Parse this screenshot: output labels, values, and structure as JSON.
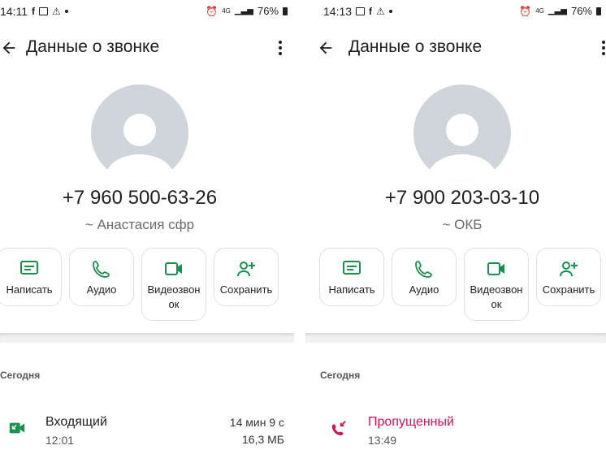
{
  "left": {
    "status": {
      "time": "14:11",
      "network": "4G",
      "battery": "76%"
    },
    "title": "Данные о звонке",
    "phone": "+7 960 500-63-26",
    "name": "~ Анастасия сфр",
    "actions": [
      {
        "label": "Написать",
        "icon": "message-icon"
      },
      {
        "label": "Аудио",
        "icon": "phone-icon"
      },
      {
        "label": "Видеозвон\nок",
        "icon": "video-icon"
      },
      {
        "label": "Сохранить",
        "icon": "add-contact-icon"
      }
    ],
    "section": "Сегодня",
    "call": {
      "type": "Входящий",
      "time": "12:01",
      "duration": "14 мин 9 с",
      "size": "16,3 МБ",
      "icon": "incoming-video-call-icon"
    }
  },
  "right": {
    "status": {
      "time": "14:13",
      "network": "4G",
      "battery": "76%"
    },
    "title": "Данные о звонке",
    "phone": "+7 900 203-03-10",
    "name": "~ ОКБ",
    "actions": [
      {
        "label": "Написать",
        "icon": "message-icon"
      },
      {
        "label": "Аудио",
        "icon": "phone-icon"
      },
      {
        "label": "Видеозвон\nок",
        "icon": "video-icon"
      },
      {
        "label": "Сохранить",
        "icon": "add-contact-icon"
      }
    ],
    "section": "Сегодня",
    "call": {
      "type": "Пропущенный",
      "time": "13:49",
      "icon": "missed-call-icon"
    }
  },
  "colors": {
    "accent": "#1a8f4e",
    "missed": "#d3124f",
    "avatar_bg": "#d0d5dc"
  }
}
